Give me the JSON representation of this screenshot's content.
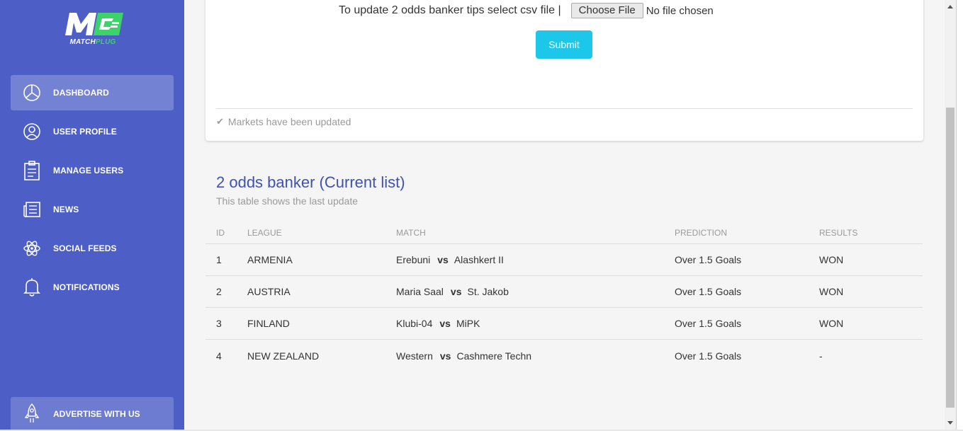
{
  "brand": {
    "name": "MATCHPLUG",
    "name_part1": "MATCH",
    "name_part2": "PLUG"
  },
  "sidebar": {
    "items": [
      {
        "label": "DASHBOARD",
        "icon": "pie-chart-icon",
        "active": true
      },
      {
        "label": "USER PROFILE",
        "icon": "user-circle-icon",
        "active": false
      },
      {
        "label": "MANAGE USERS",
        "icon": "clipboard-icon",
        "active": false
      },
      {
        "label": "NEWS",
        "icon": "newspaper-icon",
        "active": false
      },
      {
        "label": "SOCIAL FEEDS",
        "icon": "atom-icon",
        "active": false
      },
      {
        "label": "NOTIFICATIONS",
        "icon": "bell-icon",
        "active": false
      }
    ],
    "advertise": {
      "label": "ADVERTISE WITH US",
      "icon": "rocket-icon"
    }
  },
  "upload_card": {
    "prompt": "To update 2 odds banker tips select csv file |",
    "file_button": "Choose File",
    "file_status": "No file chosen",
    "submit_label": "Submit",
    "footer_message": "Markets have been updated"
  },
  "table_section": {
    "title": "2 odds banker (Current list)",
    "subtitle": "This table shows the last update",
    "columns": [
      "ID",
      "LEAGUE",
      "MATCH",
      "PREDICTION",
      "RESULTS"
    ],
    "vs_label": "vs",
    "rows": [
      {
        "id": "1",
        "league": "ARMENIA",
        "home": "Erebuni",
        "away": "Alashkert II",
        "prediction": "Over 1.5 Goals",
        "result": "WON"
      },
      {
        "id": "2",
        "league": "AUSTRIA",
        "home": "Maria Saal",
        "away": "St. Jakob",
        "prediction": "Over 1.5 Goals",
        "result": "WON"
      },
      {
        "id": "3",
        "league": "FINLAND",
        "home": "Klubi-04",
        "away": "MiPK",
        "prediction": "Over 1.5 Goals",
        "result": "WON"
      },
      {
        "id": "4",
        "league": "NEW ZEALAND",
        "home": "Western",
        "away": "Cashmere Techn",
        "prediction": "Over 1.5 Goals",
        "result": "-"
      }
    ]
  },
  "colors": {
    "sidebar": "#4d5fc7",
    "accent": "#1dc7ea",
    "title": "#3f51b5",
    "logo_green": "#3dd36b"
  }
}
